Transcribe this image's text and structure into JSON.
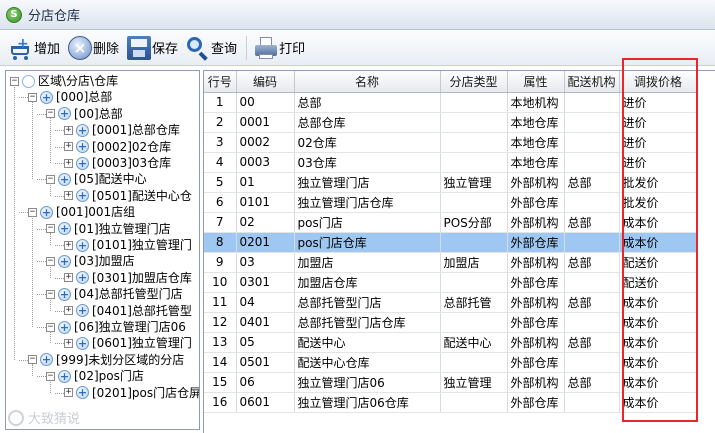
{
  "window": {
    "title": "分店仓库"
  },
  "toolbar": {
    "add_label": "增加",
    "delete_label": "删除",
    "save_label": "保存",
    "query_label": "查询",
    "print_label": "打印"
  },
  "tree": [
    {
      "label": "区域\\分店\\仓库",
      "level": 0,
      "expander": "−",
      "icon": "root-node-icon"
    },
    {
      "label": "[000]总部",
      "level": 1,
      "expander": "−",
      "icon": "node-plus-icon"
    },
    {
      "label": "[00]总部",
      "level": 2,
      "expander": "−",
      "icon": "node-plus-icon"
    },
    {
      "label": "[0001]总部仓库",
      "level": 3,
      "expander": "+",
      "icon": "node-plus-icon"
    },
    {
      "label": "[0002]02仓库",
      "level": 3,
      "expander": "+",
      "icon": "node-plus-icon"
    },
    {
      "label": "[0003]03仓库",
      "level": 3,
      "expander": "+",
      "icon": "node-plus-icon"
    },
    {
      "label": "[05]配送中心",
      "level": 2,
      "expander": "−",
      "icon": "node-plus-icon"
    },
    {
      "label": "[0501]配送中心仓",
      "level": 3,
      "expander": "+",
      "icon": "node-plus-icon"
    },
    {
      "label": "[001]001店组",
      "level": 1,
      "expander": "−",
      "icon": "node-plus-icon"
    },
    {
      "label": "[01]独立管理门店",
      "level": 2,
      "expander": "−",
      "icon": "node-plus-icon"
    },
    {
      "label": "[0101]独立管理门",
      "level": 3,
      "expander": "+",
      "icon": "node-plus-icon"
    },
    {
      "label": "[03]加盟店",
      "level": 2,
      "expander": "−",
      "icon": "node-plus-icon"
    },
    {
      "label": "[0301]加盟店仓库",
      "level": 3,
      "expander": "+",
      "icon": "node-plus-icon"
    },
    {
      "label": "[04]总部托管型门店",
      "level": 2,
      "expander": "−",
      "icon": "node-plus-icon"
    },
    {
      "label": "[0401]总部托管型",
      "level": 3,
      "expander": "+",
      "icon": "node-plus-icon"
    },
    {
      "label": "[06]独立管理门店06",
      "level": 2,
      "expander": "−",
      "icon": "node-plus-icon"
    },
    {
      "label": "[0601]独立管理门",
      "level": 3,
      "expander": "+",
      "icon": "node-plus-icon"
    },
    {
      "label": "[999]未划分区域的分店",
      "level": 1,
      "expander": "−",
      "icon": "node-plus-icon"
    },
    {
      "label": "[02]pos门店",
      "level": 2,
      "expander": "−",
      "icon": "node-plus-icon"
    },
    {
      "label": "[0201]pos门店仓屏",
      "level": 3,
      "expander": "+",
      "icon": "node-plus-icon"
    }
  ],
  "grid": {
    "columns": [
      "行号",
      "编码",
      "名称",
      "分店类型",
      "属性",
      "配送机构",
      "调拨价格"
    ],
    "selected_row": 7,
    "rows": [
      [
        "1",
        "00",
        "总部",
        "",
        "本地机构",
        "",
        "进价"
      ],
      [
        "2",
        "0001",
        "总部仓库",
        "",
        "本地仓库",
        "",
        "进价"
      ],
      [
        "3",
        "0002",
        "02仓库",
        "",
        "本地仓库",
        "",
        "进价"
      ],
      [
        "4",
        "0003",
        "03仓库",
        "",
        "本地仓库",
        "",
        "进价"
      ],
      [
        "5",
        "01",
        "独立管理门店",
        "独立管理",
        "外部机构",
        "总部",
        "批发价"
      ],
      [
        "6",
        "0101",
        "独立管理门店仓库",
        "",
        "外部仓库",
        "",
        "批发价"
      ],
      [
        "7",
        "02",
        "pos门店",
        "POS分部",
        "外部机构",
        "总部",
        "成本价"
      ],
      [
        "8",
        "0201",
        "pos门店仓库",
        "",
        "外部仓库",
        "",
        "成本价"
      ],
      [
        "9",
        "03",
        "加盟店",
        "加盟店",
        "外部机构",
        "总部",
        "配送价"
      ],
      [
        "10",
        "0301",
        "加盟店仓库",
        "",
        "外部仓库",
        "",
        "配送价"
      ],
      [
        "11",
        "04",
        "总部托管型门店",
        "总部托管",
        "外部机构",
        "总部",
        "成本价"
      ],
      [
        "12",
        "0401",
        "总部托管型门店仓库",
        "",
        "外部仓库",
        "",
        "成本价"
      ],
      [
        "13",
        "05",
        "配送中心",
        "配送中心",
        "外部机构",
        "总部",
        "成本价"
      ],
      [
        "14",
        "0501",
        "配送中心仓库",
        "",
        "外部仓库",
        "",
        "成本价"
      ],
      [
        "15",
        "06",
        "独立管理门店06",
        "独立管理",
        "外部机构",
        "总部",
        "成本价"
      ],
      [
        "16",
        "0601",
        "独立管理门店06仓库",
        "",
        "外部仓库",
        "",
        "成本价"
      ]
    ]
  },
  "watermark": {
    "text": "大致猜说"
  },
  "colors": {
    "selected_row": "#9ec7f2",
    "highlight_box": "#e8262b"
  }
}
